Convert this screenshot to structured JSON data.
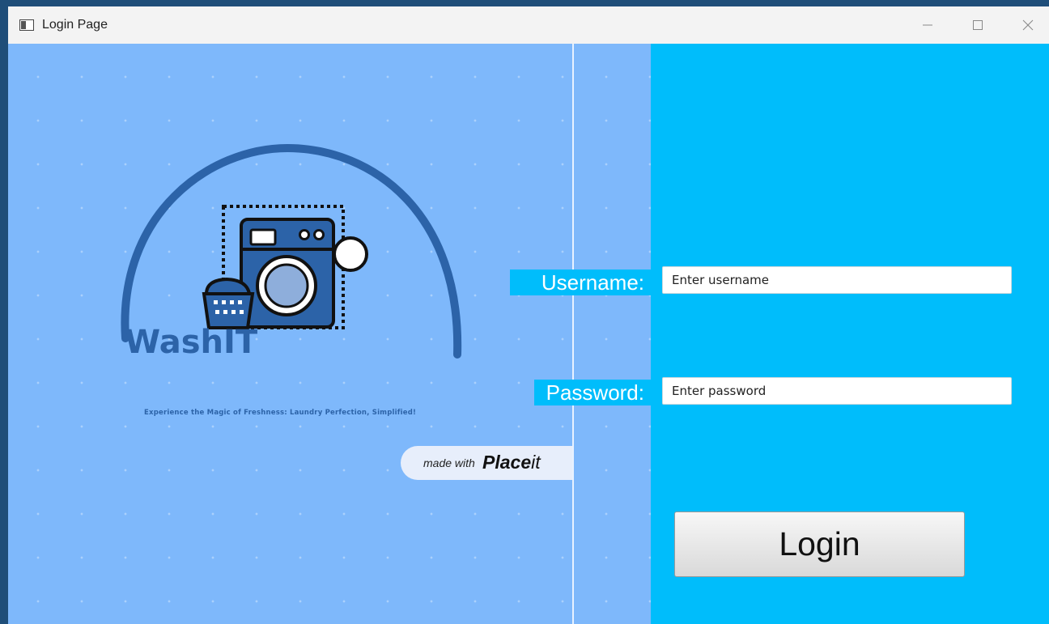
{
  "window": {
    "title": "Login Page",
    "controls": {
      "minimize": "minimize-icon",
      "maximize": "maximize-icon",
      "close": "close-icon"
    }
  },
  "branding": {
    "name": "WashIT",
    "tagline": "Experience the Magic of Freshness: Laundry Perfection, Simplified!",
    "logo_icon": "washing-machine-icon",
    "watermark": {
      "made_with": "made with",
      "brand": "Place",
      "brand_suffix": "it"
    }
  },
  "form": {
    "username_label": "Username:",
    "username_placeholder": "Enter username",
    "password_label": "Password:",
    "password_placeholder": "Enter password",
    "login_label": "Login"
  },
  "colors": {
    "left_panel": "#7eb8fb",
    "right_panel": "#00bdfb",
    "logo_blue": "#2c63a8"
  }
}
